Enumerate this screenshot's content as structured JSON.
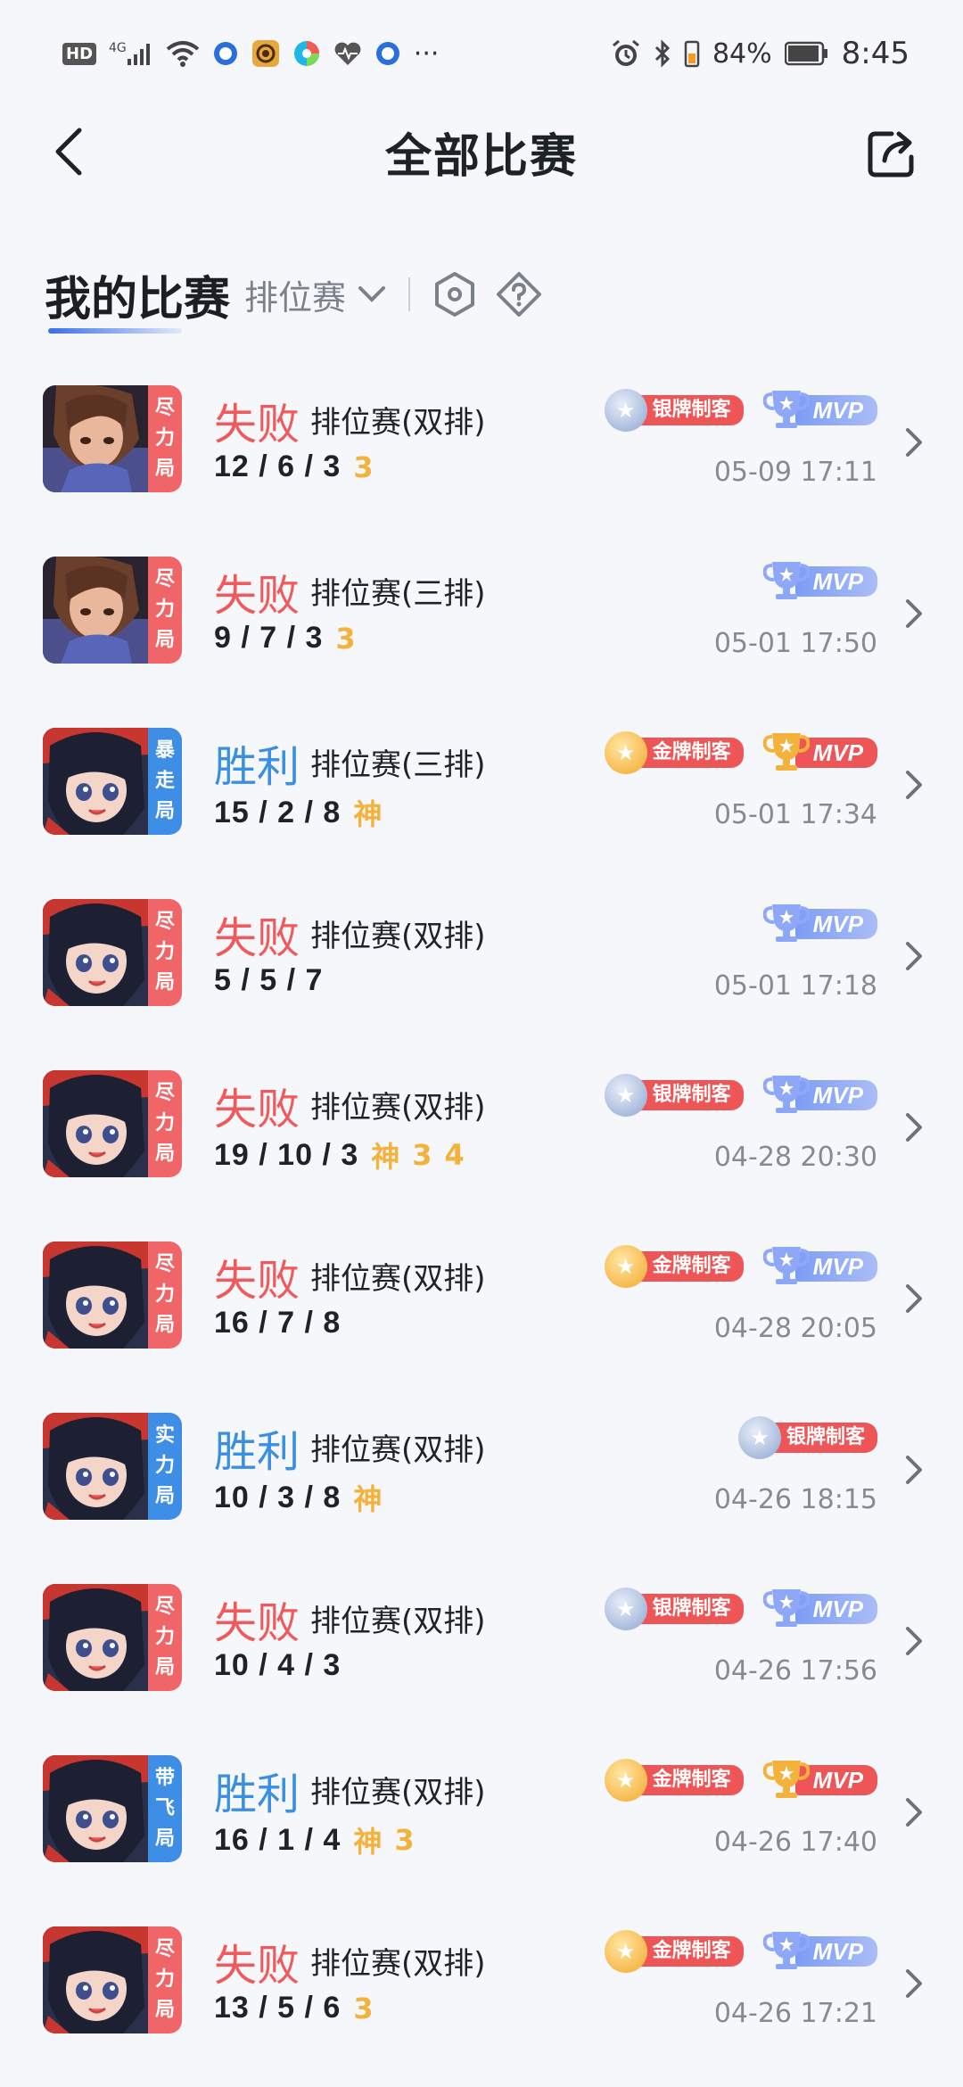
{
  "status_bar": {
    "hd_label": "HD",
    "network_label": "4G",
    "battery_percent": "84%",
    "time": "8:45",
    "more_label": "···"
  },
  "navbar": {
    "title": "全部比赛"
  },
  "section": {
    "title": "我的比赛",
    "filter_label": "排位赛"
  },
  "colors": {
    "lose": "#ef5a5c",
    "win": "#3a8fe0",
    "honor": "#f3b23b",
    "mvp_blue": "#8ea8f6",
    "badge_red": "#ee5557"
  },
  "matches": [
    {
      "result": "失败",
      "outcome": "lose",
      "mode": "排位赛(双排)",
      "kda": "12 / 6 / 3",
      "honors": [
        "3"
      ],
      "tag": [
        "尽",
        "力",
        "局"
      ],
      "tag_color": "red",
      "hero": "hero-boy",
      "medal": "银牌制客",
      "medal_type": "silver",
      "mvp": "MVP",
      "mvp_type": "blue",
      "datetime": "05-09 17:11"
    },
    {
      "result": "失败",
      "outcome": "lose",
      "mode": "排位赛(三排)",
      "kda": "9 / 7 / 3",
      "honors": [
        "3"
      ],
      "tag": [
        "尽",
        "力",
        "局"
      ],
      "tag_color": "red",
      "hero": "hero-boy",
      "medal": "",
      "medal_type": "",
      "mvp": "MVP",
      "mvp_type": "blue",
      "datetime": "05-01 17:50"
    },
    {
      "result": "胜利",
      "outcome": "win",
      "mode": "排位赛(三排)",
      "kda": "15 / 2 / 8",
      "honors": [
        "神"
      ],
      "tag": [
        "暴",
        "走",
        "局"
      ],
      "tag_color": "blue",
      "hero": "hero-girl",
      "medal": "金牌制客",
      "medal_type": "gold",
      "mvp": "MVP",
      "mvp_type": "red",
      "datetime": "05-01 17:34"
    },
    {
      "result": "失败",
      "outcome": "lose",
      "mode": "排位赛(双排)",
      "kda": "5 / 5 / 7",
      "honors": [],
      "tag": [
        "尽",
        "力",
        "局"
      ],
      "tag_color": "red",
      "hero": "hero-girl",
      "medal": "",
      "medal_type": "",
      "mvp": "MVP",
      "mvp_type": "blue",
      "datetime": "05-01 17:18"
    },
    {
      "result": "失败",
      "outcome": "lose",
      "mode": "排位赛(双排)",
      "kda": "19 / 10 / 3",
      "honors": [
        "神",
        "3",
        "4"
      ],
      "tag": [
        "尽",
        "力",
        "局"
      ],
      "tag_color": "red",
      "hero": "hero-girl",
      "medal": "银牌制客",
      "medal_type": "silver",
      "mvp": "MVP",
      "mvp_type": "blue",
      "datetime": "04-28 20:30"
    },
    {
      "result": "失败",
      "outcome": "lose",
      "mode": "排位赛(双排)",
      "kda": "16 / 7 / 8",
      "honors": [],
      "tag": [
        "尽",
        "力",
        "局"
      ],
      "tag_color": "red",
      "hero": "hero-girl",
      "medal": "金牌制客",
      "medal_type": "gold",
      "mvp": "MVP",
      "mvp_type": "blue",
      "datetime": "04-28 20:05"
    },
    {
      "result": "胜利",
      "outcome": "win",
      "mode": "排位赛(双排)",
      "kda": "10 / 3 / 8",
      "honors": [
        "神"
      ],
      "tag": [
        "实",
        "力",
        "局"
      ],
      "tag_color": "blue",
      "hero": "hero-girl",
      "medal": "银牌制客",
      "medal_type": "silver",
      "mvp": "",
      "mvp_type": "",
      "datetime": "04-26 18:15"
    },
    {
      "result": "失败",
      "outcome": "lose",
      "mode": "排位赛(双排)",
      "kda": "10 / 4 / 3",
      "honors": [],
      "tag": [
        "尽",
        "力",
        "局"
      ],
      "tag_color": "red",
      "hero": "hero-girl",
      "medal": "银牌制客",
      "medal_type": "silver",
      "mvp": "MVP",
      "mvp_type": "blue",
      "datetime": "04-26 17:56"
    },
    {
      "result": "胜利",
      "outcome": "win",
      "mode": "排位赛(双排)",
      "kda": "16 / 1 / 4",
      "honors": [
        "神",
        "3"
      ],
      "tag": [
        "带",
        "飞",
        "局"
      ],
      "tag_color": "blue",
      "hero": "hero-girl",
      "medal": "金牌制客",
      "medal_type": "gold",
      "mvp": "MVP",
      "mvp_type": "red",
      "datetime": "04-26 17:40"
    },
    {
      "result": "失败",
      "outcome": "lose",
      "mode": "排位赛(双排)",
      "kda": "13 / 5 / 6",
      "honors": [
        "3"
      ],
      "tag": [
        "尽",
        "力",
        "局"
      ],
      "tag_color": "red",
      "hero": "hero-girl",
      "medal": "金牌制客",
      "medal_type": "gold",
      "mvp": "MVP",
      "mvp_type": "blue",
      "datetime": "04-26 17:21"
    }
  ]
}
